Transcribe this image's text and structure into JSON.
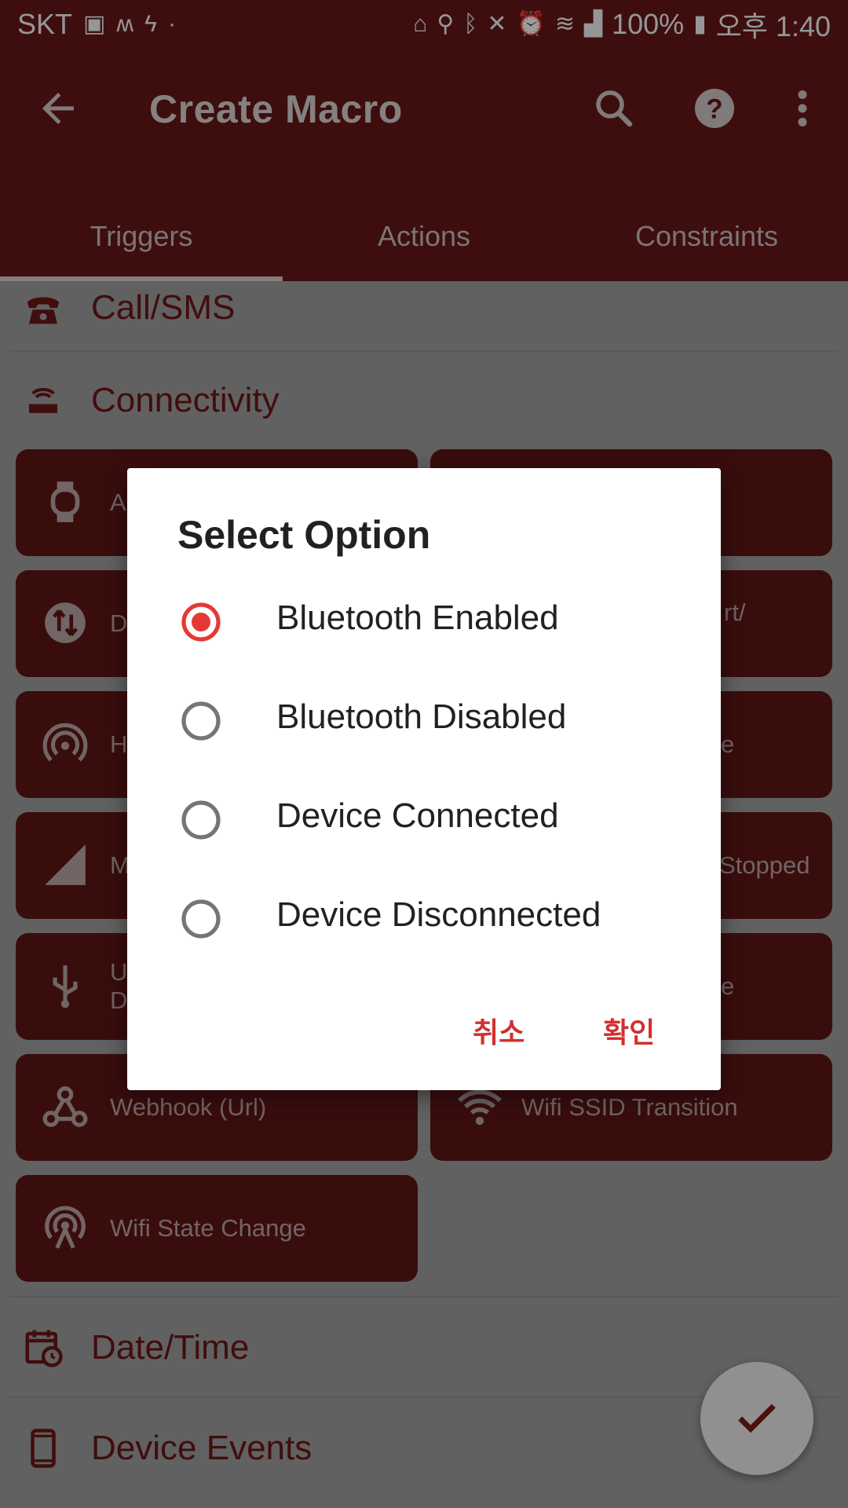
{
  "status_bar": {
    "carrier": "SKT",
    "battery": "100%",
    "time": "오후 1:40"
  },
  "app_bar": {
    "title": "Create Macro",
    "tabs": [
      {
        "label": "Triggers",
        "selected": true
      },
      {
        "label": "Actions",
        "selected": false
      },
      {
        "label": "Constraints",
        "selected": false
      }
    ]
  },
  "list": {
    "categories": [
      {
        "label": "Call/SMS",
        "icon": "phone-icon"
      },
      {
        "label": "Connectivity",
        "icon": "router-icon"
      },
      {
        "label": "Date/Time",
        "icon": "calendar-clock-icon"
      },
      {
        "label": "Device Events",
        "icon": "phone-device-icon"
      }
    ],
    "tiles_left": [
      {
        "label": "Ar",
        "icon": "watch-icon"
      },
      {
        "label": "Da",
        "icon": "data-transfer-icon"
      },
      {
        "label": "Ho",
        "icon": "hotspot-icon"
      },
      {
        "label": "M",
        "icon": "signal-icon"
      },
      {
        "label": "US\nDi",
        "icon": "usb-icon"
      },
      {
        "label": "Webhook (Url)",
        "icon": "webhook-icon"
      },
      {
        "label": "Wifi State Change",
        "icon": "wifi-tower-icon"
      }
    ],
    "tiles_right": [
      {
        "label": ""
      },
      {
        "label": "rt/"
      },
      {
        "label": "e"
      },
      {
        "label": "Stopped"
      },
      {
        "label": "e"
      },
      {
        "label": "Wifi SSID Transition",
        "icon": "wifi-icon"
      }
    ]
  },
  "dialog": {
    "title": "Select Option",
    "options": [
      {
        "label": "Bluetooth Enabled",
        "selected": true
      },
      {
        "label": "Bluetooth Disabled",
        "selected": false
      },
      {
        "label": "Device Connected",
        "selected": false
      },
      {
        "label": "Device Disconnected",
        "selected": false
      }
    ],
    "cancel_label": "취소",
    "confirm_label": "확인"
  },
  "colors": {
    "primary": "#B71C1C",
    "accent": "#E53935",
    "dialog_button": "#D32F2F"
  },
  "fab": {
    "icon": "check-icon"
  }
}
